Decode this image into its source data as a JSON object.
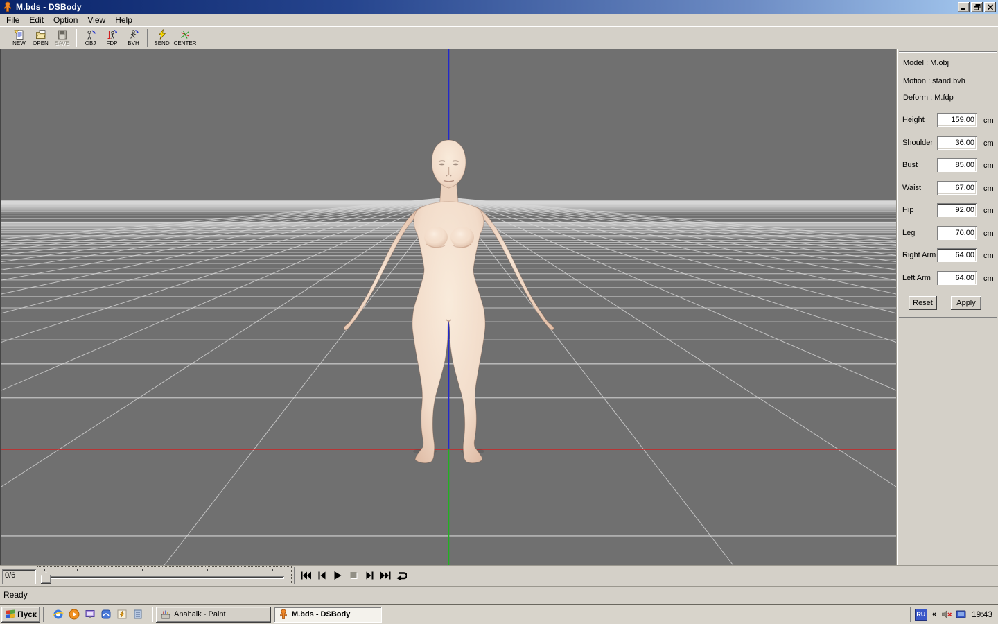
{
  "window": {
    "title": "M.bds - DSBody"
  },
  "menu": {
    "items": [
      "File",
      "Edit",
      "Option",
      "View",
      "Help"
    ]
  },
  "toolbar": {
    "buttons": [
      "NEW",
      "OPEN",
      "SAVE",
      "OBJ",
      "FDP",
      "BVH",
      "SEND",
      "CENTER"
    ]
  },
  "viewport": {
    "background": "#707070",
    "grid_color": "rgba(215,215,215,0.8)",
    "axis_x_color": "#cc2222",
    "axis_up_color": "#2228cc",
    "axis_ground_color": "#22b022",
    "model_skin_color": "#f2dcca"
  },
  "panel": {
    "info": {
      "model": "Model : M.obj",
      "motion": "Motion : stand.bvh",
      "deform": "Deform : M.fdp"
    },
    "fields": [
      {
        "label": "Height",
        "value": "159.00",
        "unit": "cm"
      },
      {
        "label": "Shoulder",
        "value": "36.00",
        "unit": "cm"
      },
      {
        "label": "Bust",
        "value": "85.00",
        "unit": "cm"
      },
      {
        "label": "Waist",
        "value": "67.00",
        "unit": "cm"
      },
      {
        "label": "Hip",
        "value": "92.00",
        "unit": "cm"
      },
      {
        "label": "Leg",
        "value": "70.00",
        "unit": "cm"
      },
      {
        "label": "Right Arm",
        "value": "64.00",
        "unit": "cm"
      },
      {
        "label": "Left Arm",
        "value": "64.00",
        "unit": "cm"
      }
    ],
    "buttons": {
      "reset": "Reset",
      "apply": "Apply"
    }
  },
  "playback": {
    "frame_counter": "0/6"
  },
  "statusbar": {
    "text": "Ready"
  },
  "taskbar": {
    "start_label": "Пуск",
    "tasks": [
      {
        "label": "Anahaik - Paint"
      },
      {
        "label": "M.bds - DSBody"
      }
    ],
    "tray": {
      "language": "RU",
      "collapse": "«",
      "clock": "19:43"
    }
  }
}
